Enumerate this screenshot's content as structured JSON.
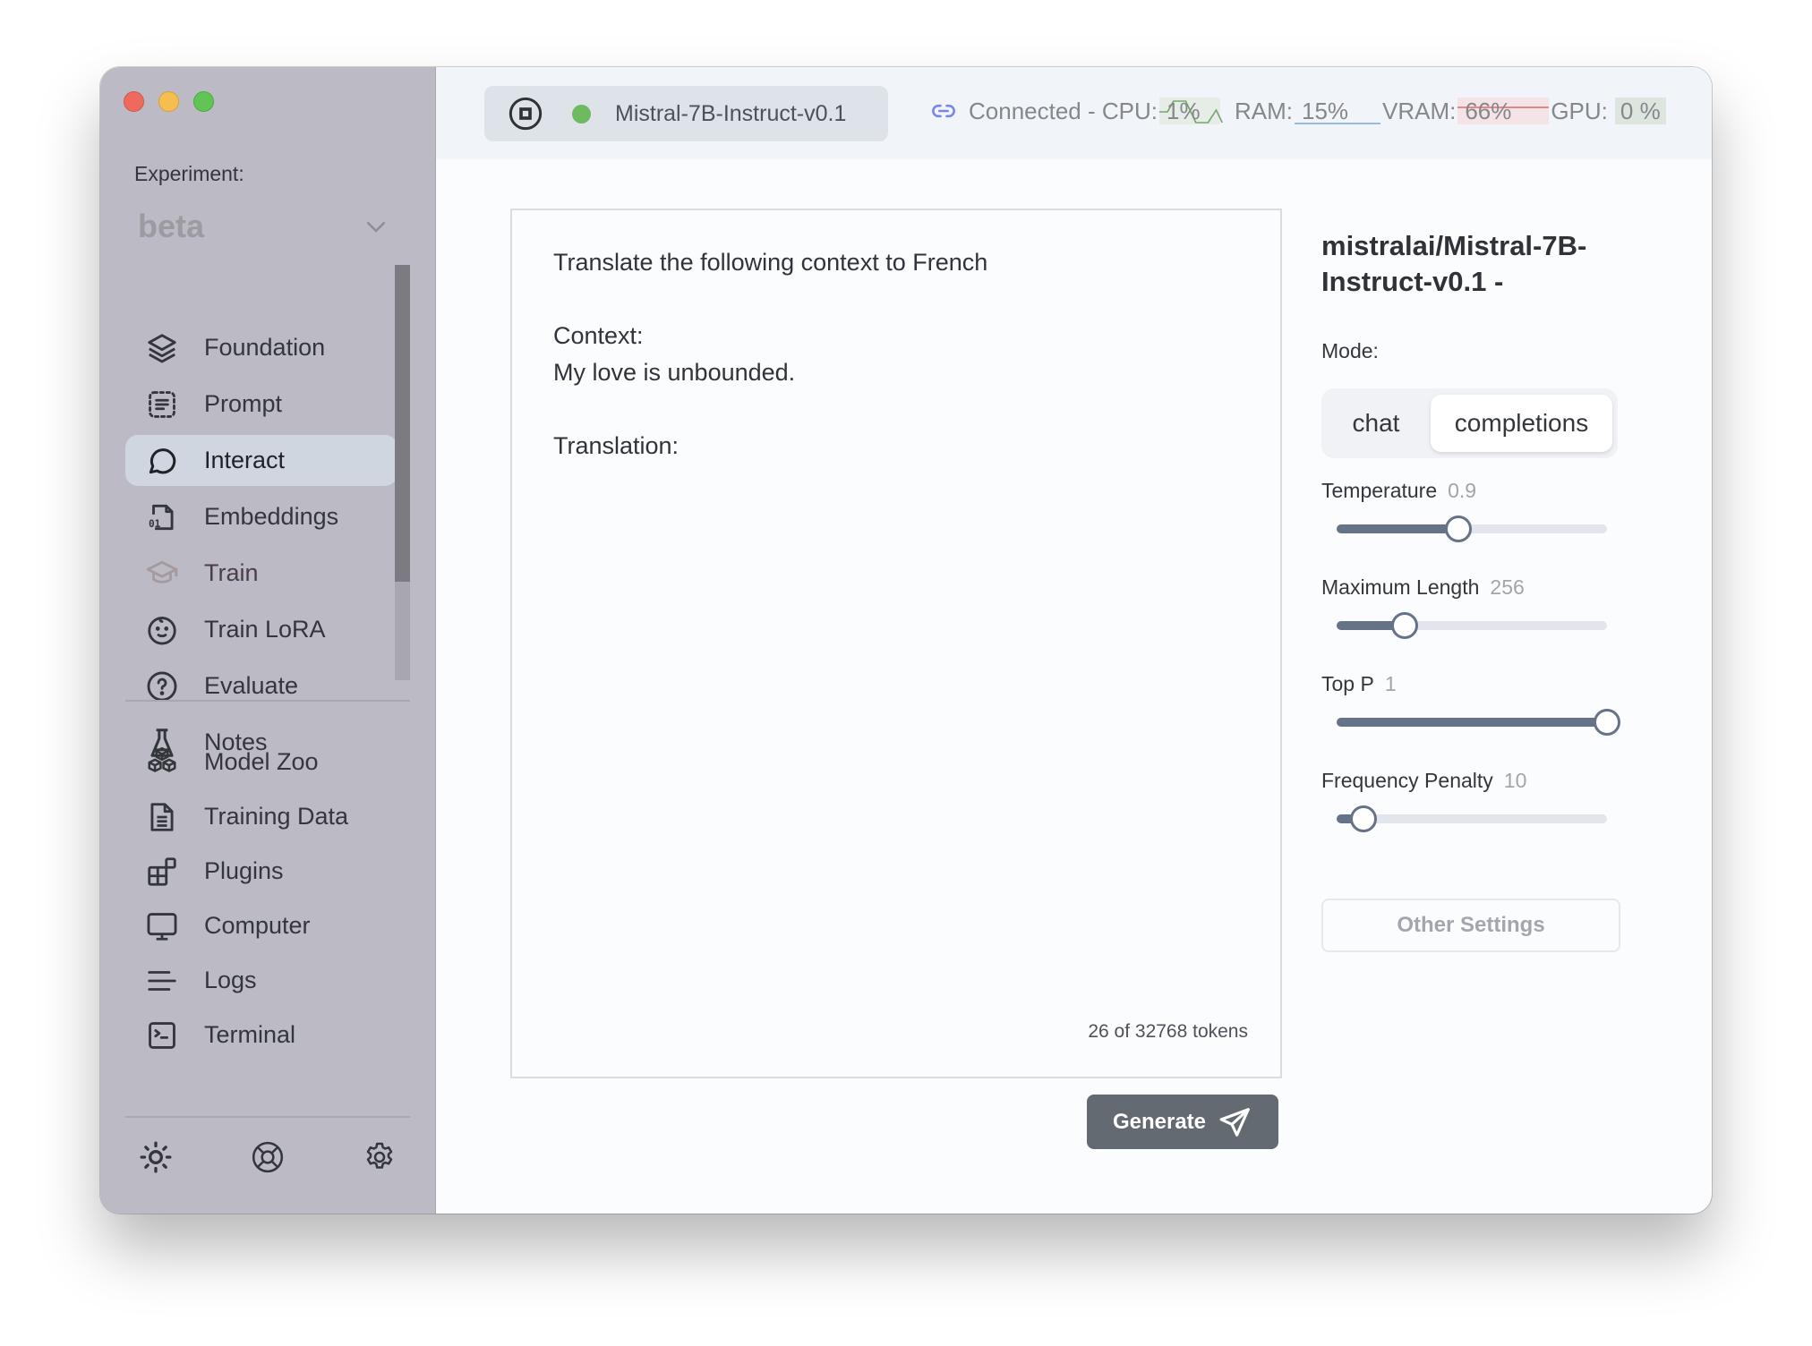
{
  "window": {
    "traffic_lights": [
      "close",
      "minimize",
      "maximize"
    ]
  },
  "sidebar": {
    "experiment_label": "Experiment:",
    "experiment_value": "beta",
    "items": [
      {
        "label": "Foundation",
        "icon": "layers-icon"
      },
      {
        "label": "Prompt",
        "icon": "prompt-icon"
      },
      {
        "label": "Interact",
        "icon": "chat-bubble-icon",
        "active": true
      },
      {
        "label": "Embeddings",
        "icon": "binary-file-icon"
      },
      {
        "label": "Train",
        "icon": "graduation-cap-icon"
      },
      {
        "label": "Train LoRA",
        "icon": "baby-face-icon"
      },
      {
        "label": "Evaluate",
        "icon": "question-circle-icon"
      },
      {
        "label": "Notes",
        "icon": "flask-icon"
      }
    ],
    "items2": [
      {
        "label": "Model Zoo",
        "icon": "cubes-icon"
      },
      {
        "label": "Training Data",
        "icon": "document-icon"
      },
      {
        "label": "Plugins",
        "icon": "plugins-icon"
      },
      {
        "label": "Computer",
        "icon": "monitor-icon"
      },
      {
        "label": "Logs",
        "icon": "lines-icon"
      },
      {
        "label": "Terminal",
        "icon": "terminal-icon"
      }
    ],
    "bottom_icons": [
      "sun-icon",
      "lifebuoy-icon",
      "gear-icon"
    ]
  },
  "topbar": {
    "model_name": "Mistral-7B-Instruct-v0.1",
    "status_color": "#6dba5f",
    "connection": "Connected - CPU:",
    "cpu": "1%",
    "ram_label": "RAM:",
    "ram": "15%",
    "vram_label": "VRAM:",
    "vram": "66%",
    "gpu_label": "GPU:",
    "gpu": "0 %"
  },
  "prompt": {
    "text": "Translate the following context to French\n\nContext:\nMy love is unbounded.\n\nTranslation:",
    "token_count": "26 of 32768 tokens"
  },
  "actions": {
    "generate_label": "Generate"
  },
  "settings": {
    "model_title": "mistralai/Mistral-7B-Instruct-v0.1 -",
    "mode_label": "Mode:",
    "modes": [
      "chat",
      "completions"
    ],
    "selected_mode": "completions",
    "sliders": [
      {
        "label": "Temperature",
        "value": "0.9",
        "fraction": 0.45
      },
      {
        "label": "Maximum Length",
        "value": "256",
        "fraction": 0.25
      },
      {
        "label": "Top P",
        "value": "1",
        "fraction": 1.0
      },
      {
        "label": "Frequency Penalty",
        "value": "10",
        "fraction": 0.1
      }
    ],
    "other_settings_label": "Other Settings"
  }
}
